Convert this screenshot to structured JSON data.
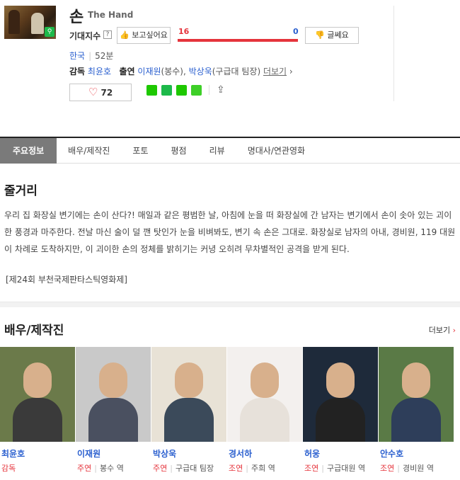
{
  "movie": {
    "title_ko": "손",
    "title_en": "The Hand",
    "expect_label": "기대지수",
    "help_mark": "?",
    "want_label": "보고싶어요",
    "meh_label": "글쎄요",
    "want_count": "16",
    "meh_count": "0",
    "want_ratio": 1.0,
    "country": "한국",
    "runtime": "52분",
    "director_label": "감독",
    "director": "최윤호",
    "cast_label": "출연",
    "cast_line_1": "이재원",
    "cast_role_1": "(봉수), ",
    "cast_line_2": "박상욱",
    "cast_role_2": "(구급대 팀장) ",
    "more_label": "더보기",
    "likes": "72"
  },
  "colors": {
    "accent_red": "#e5343c",
    "link_blue": "#2a5fcf",
    "tab_active_bg": "#7a7a7a"
  },
  "tabs": [
    {
      "label": "주요정보",
      "active": true
    },
    {
      "label": "배우/제작진",
      "active": false
    },
    {
      "label": "포토",
      "active": false
    },
    {
      "label": "평점",
      "active": false
    },
    {
      "label": "리뷰",
      "active": false
    },
    {
      "label": "명대사/연관영화",
      "active": false
    }
  ],
  "story": {
    "title": "줄거리",
    "text": "우리 집 화장실 변기에는 손이 산다?! 매일과 같은 평범한 날, 아침에 눈을 떠 화장실에 간 남자는 변기에서 손이 솟아 있는 괴이한 풍경과 마주한다. 전날 마신 술이 덜 깬 탓인가 눈을 비벼봐도, 변기 속 손은 그대로. 화장실로 남자의 아내, 경비원, 119 대원이 차례로 도착하지만, 이 괴이한 손의 정체를 밝히기는 커녕 오히려 무차별적인 공격을 받게 된다.",
    "award": "[제24회 부천국제판타스틱영화제]"
  },
  "cast_section": {
    "title": "배우/제작진",
    "more": "더보기"
  },
  "people": [
    {
      "name": "최윤호",
      "role": "감독",
      "character": "",
      "bg": "#6b7a4a",
      "clothes": "#3a3a3a"
    },
    {
      "name": "이재원",
      "role": "주연",
      "character": "봉수 역",
      "bg": "#c9c9c9",
      "clothes": "#4a5060"
    },
    {
      "name": "박상욱",
      "role": "주연",
      "character": "구급대 팀장",
      "bg": "#e8e2d6",
      "clothes": "#3b4a5a"
    },
    {
      "name": "경서하",
      "role": "조연",
      "character": "주희 역",
      "bg": "#f3f0ee",
      "clothes": "#e7e1da"
    },
    {
      "name": "허웅",
      "role": "조연",
      "character": "구급대원 역",
      "bg": "#1e2a3a",
      "clothes": "#222"
    },
    {
      "name": "안수호",
      "role": "조연",
      "character": "경비원 역",
      "bg": "#5a7a46",
      "clothes": "#2e3e5a"
    }
  ]
}
